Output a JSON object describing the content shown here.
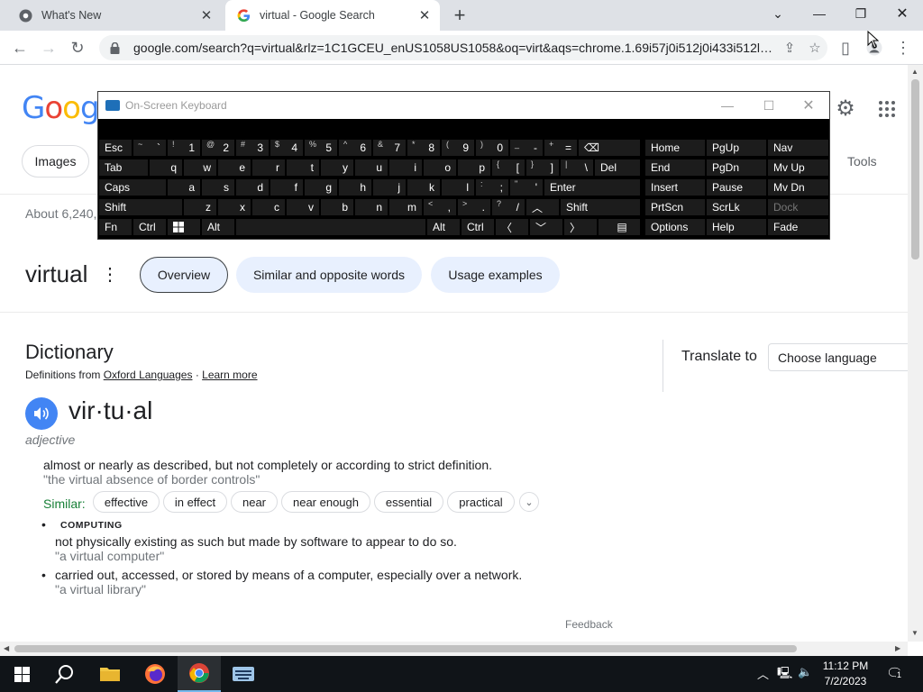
{
  "browser": {
    "tabs": [
      {
        "title": "What's New",
        "icon": "chrome-icon"
      },
      {
        "title": "virtual - Google Search",
        "icon": "google-icon"
      }
    ],
    "url": "google.com/search?q=virtual&rlz=1C1GCEU_enUS1058US1058&oq=virt&aqs=chrome.1.69i57j0i512j0i433i512l5..."
  },
  "google": {
    "logo": "Google",
    "filters": {
      "images": "Images",
      "tools": "Tools"
    },
    "about": "About 6,240,",
    "keyword": "virtual",
    "pills": [
      "Overview",
      "Similar and opposite words",
      "Usage examples"
    ]
  },
  "dictionary": {
    "title": "Dictionary",
    "source_prefix": "Definitions from",
    "source_link": "Oxford Languages",
    "sep": "·",
    "learn_more": "Learn more",
    "headword": "vir·tu·al",
    "part_of_speech": "adjective",
    "def1": "almost or nearly as described, but not completely or according to strict definition.",
    "ex1": "\"the virtual absence of border controls\"",
    "similar_label": "Similar:",
    "similar": [
      "effective",
      "in effect",
      "near",
      "near enough",
      "essential",
      "practical"
    ],
    "domain": "COMPUTING",
    "def2": "not physically existing as such but made by software to appear to do so.",
    "ex2": "\"a virtual computer\"",
    "def3": "carried out, accessed, or stored by means of a computer, especially over a network.",
    "ex3": "\"a virtual library\"",
    "feedback": "Feedback"
  },
  "translate": {
    "label": "Translate to",
    "select": "Choose language"
  },
  "osk": {
    "title": "On-Screen Keyboard",
    "row1": [
      "Esc"
    ],
    "nav": {
      "home": "Home",
      "pgup": "PgUp",
      "nav": "Nav",
      "end": "End",
      "pgdn": "PgDn",
      "mvup": "Mv Up",
      "insert": "Insert",
      "pause": "Pause",
      "mvdn": "Mv Dn",
      "prtscn": "PrtScn",
      "scrlk": "ScrLk",
      "dock": "Dock",
      "options": "Options",
      "help": "Help",
      "fade": "Fade"
    },
    "keys": {
      "tab": "Tab",
      "caps": "Caps",
      "shift": "Shift",
      "fn": "Fn",
      "ctrl": "Ctrl",
      "alt": "Alt",
      "del": "Del",
      "enter": "Enter"
    }
  },
  "taskbar": {
    "time": "11:12 PM",
    "date": "7/2/2023",
    "notifications": "1"
  },
  "colors": {
    "accent_blue": "#4285f4",
    "pill_bg": "#e8f0fe",
    "green": "#188038",
    "taskbar": "#101418"
  }
}
